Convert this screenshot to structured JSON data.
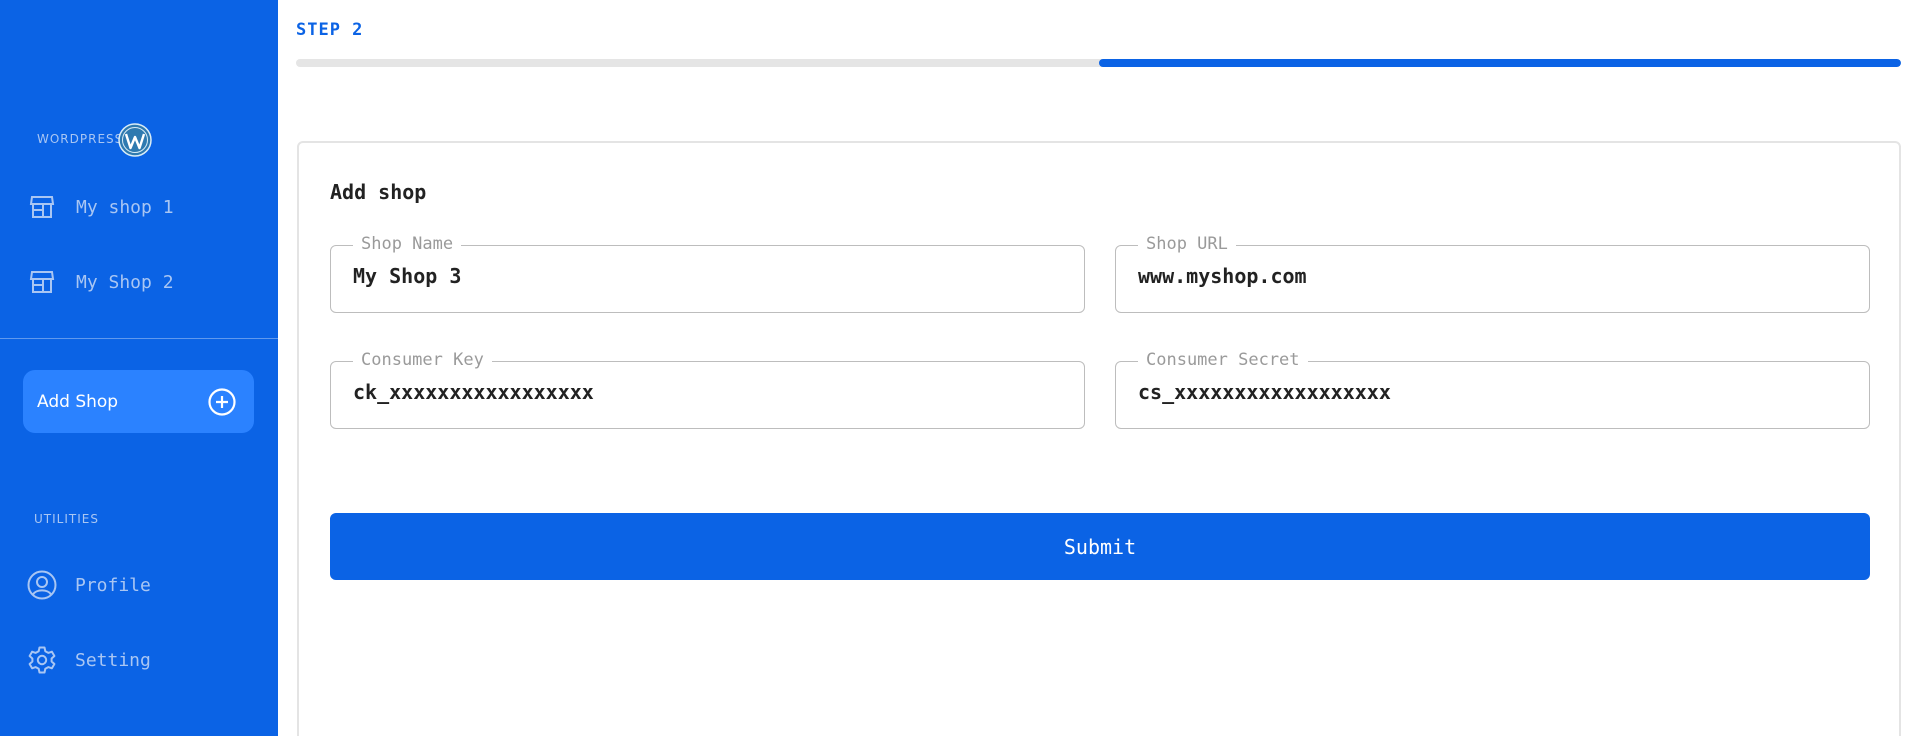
{
  "sidebar": {
    "wordpress_label": "WORDPRESS",
    "shops": [
      {
        "label": "My shop 1",
        "icon": "store-icon"
      },
      {
        "label": "My Shop 2",
        "icon": "store-icon"
      }
    ],
    "add_shop_label": "Add Shop",
    "utilities_label": "UTILITIES",
    "utilities": [
      {
        "label": "Profile",
        "icon": "user-circle-icon"
      },
      {
        "label": "Setting",
        "icon": "gear-icon"
      }
    ]
  },
  "progress": {
    "step_label": "STEP 2",
    "current_step": 2,
    "total_steps": 2,
    "filled_from": 0.5,
    "filled_to": 1.0
  },
  "form": {
    "title": "Add shop",
    "fields": {
      "shop_name": {
        "label": "Shop Name",
        "value": "My Shop 3"
      },
      "shop_url": {
        "label": "Shop URL",
        "value": "www.myshop.com"
      },
      "consumer_key": {
        "label": "Consumer Key",
        "value": "ck_xxxxxxxxxxxxxxxxx"
      },
      "consumer_secret": {
        "label": "Consumer Secret",
        "value": "cs_xxxxxxxxxxxxxxxxxx"
      }
    },
    "submit_label": "Submit"
  },
  "colors": {
    "brand": "#0b63e5",
    "sidebar_text": "#a9c6f3",
    "add_button": "#2b82ff",
    "progress_track": "#e5e5e5"
  }
}
